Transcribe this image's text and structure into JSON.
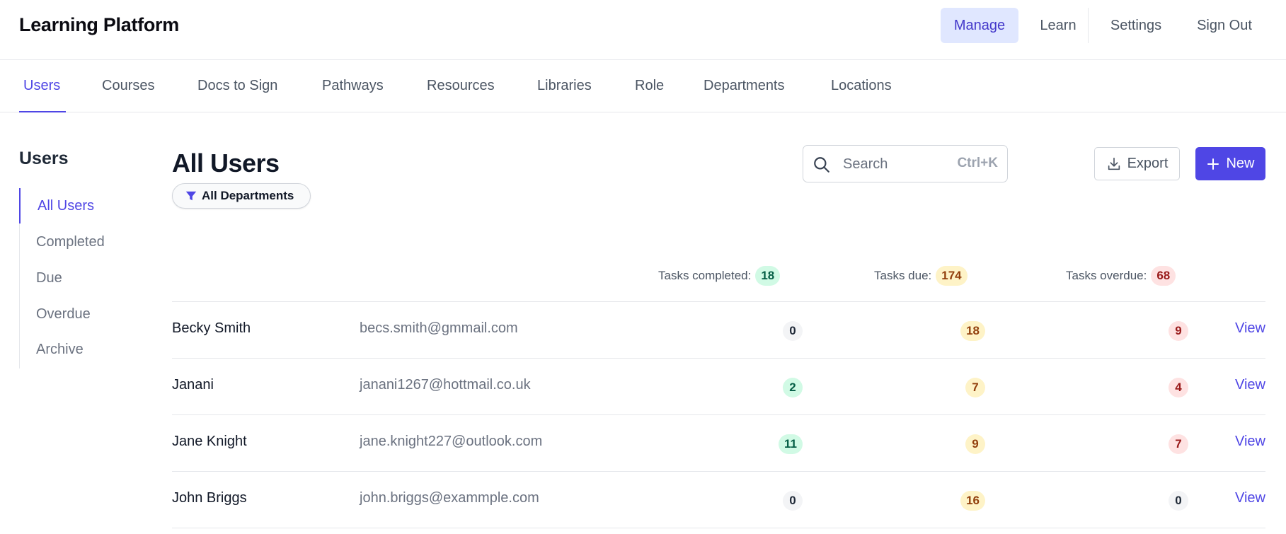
{
  "app": {
    "title": "Learning Platform"
  },
  "topnav": {
    "manage": "Manage",
    "learn": "Learn",
    "settings": "Settings",
    "signout": "Sign Out"
  },
  "tabs": [
    "Users",
    "Courses",
    "Docs to Sign",
    "Pathways",
    "Resources",
    "Libraries",
    "Role",
    "Departments",
    "Locations"
  ],
  "active_tab": "Users",
  "sidebar": {
    "title": "Users",
    "items": [
      "All Users",
      "Completed",
      "Due",
      "Overdue",
      "Archive"
    ],
    "active": "All Users"
  },
  "main": {
    "title": "All Users",
    "filter_label": "All Departments",
    "search": {
      "placeholder": "Search",
      "shortcut": "Ctrl+K",
      "value": ""
    },
    "export_label": "Export",
    "new_label": "New"
  },
  "summary": {
    "completed_label": "Tasks completed:",
    "completed": "18",
    "due_label": "Tasks due:",
    "due": "174",
    "overdue_label": "Tasks overdue:",
    "overdue": "68"
  },
  "users": [
    {
      "name": "Becky Smith",
      "email": "becs.smith@gmmail.com",
      "completed": "0",
      "due": "18",
      "overdue": "9",
      "action": "View"
    },
    {
      "name": "Janani",
      "email": "janani1267@hottmail.co.uk",
      "completed": "2",
      "due": "7",
      "overdue": "4",
      "action": "View"
    },
    {
      "name": "Jane Knight",
      "email": "jane.knight227@outlook.com",
      "completed": "11",
      "due": "9",
      "overdue": "7",
      "action": "View"
    },
    {
      "name": "John Briggs",
      "email": "john.briggs@exammple.com",
      "completed": "0",
      "due": "16",
      "overdue": "0",
      "action": "View"
    }
  ],
  "colors": {
    "accent": "#4f46e5",
    "accent_bg": "#e0e7ff",
    "green_bg": "#d1fae5",
    "yellow_bg": "#fef3c7",
    "red_bg": "#fee2e2",
    "gray_bg": "#f3f4f6"
  }
}
